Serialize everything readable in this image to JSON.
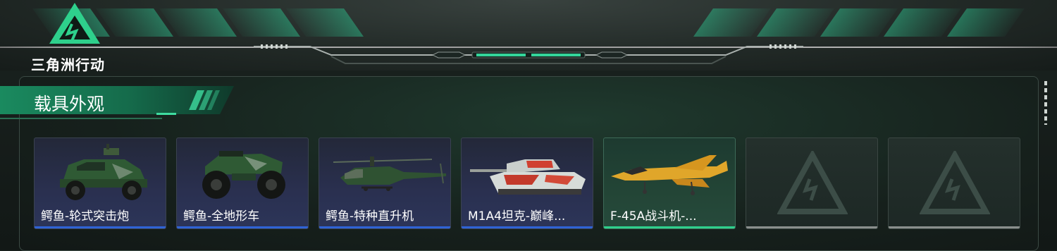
{
  "header": {
    "logo_text": "三角洲行动"
  },
  "section": {
    "title": "载具外观"
  },
  "vehicles": [
    {
      "label": "鳄鱼-轮式突击炮",
      "icon": "armored-car-icon",
      "state": "filled"
    },
    {
      "label": "鳄鱼-全地形车",
      "icon": "atv-icon",
      "state": "filled"
    },
    {
      "label": "鳄鱼-特种直升机",
      "icon": "helicopter-icon",
      "state": "filled"
    },
    {
      "label": "M1A4坦克-巅峰...",
      "icon": "tank-icon",
      "state": "filled"
    },
    {
      "label": "F-45A战斗机-...",
      "icon": "fighter-jet-icon",
      "state": "selected"
    },
    {
      "label": "",
      "icon": "empty-slot-icon",
      "state": "empty"
    },
    {
      "label": "",
      "icon": "empty-slot-icon",
      "state": "empty"
    }
  ],
  "colors": {
    "accent_green": "#2fd08d",
    "rarity_blue": "#2f63d6",
    "empty_gray": "#8a8f8d"
  }
}
